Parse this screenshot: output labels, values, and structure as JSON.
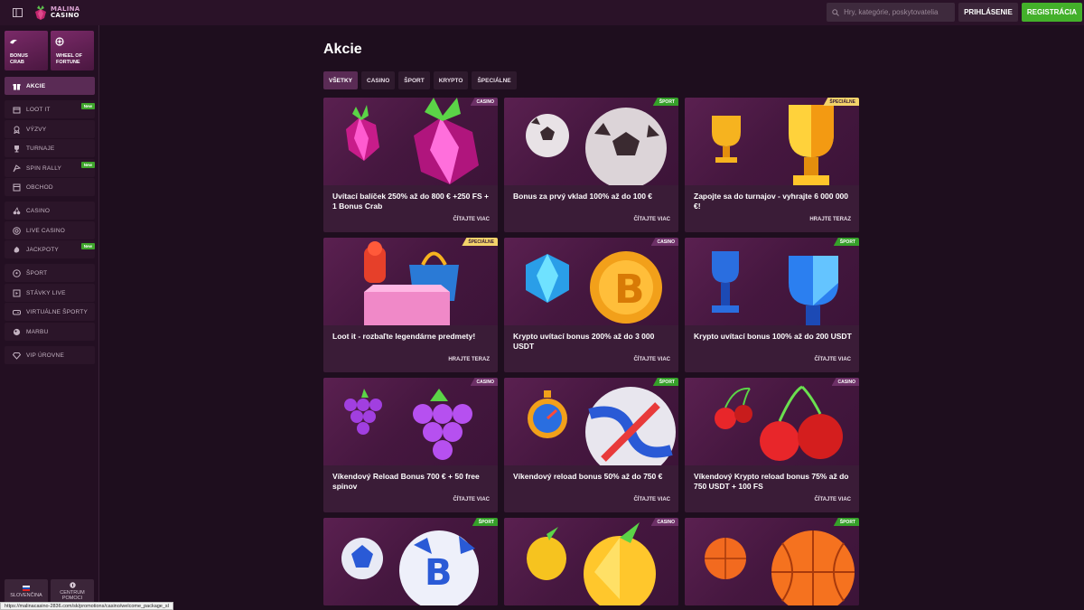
{
  "header": {
    "logo_top": "MALINA",
    "logo_bottom": "CASINO",
    "search_placeholder": "Hry, kategórie, poskytovatelia",
    "login_label": "PRIHLÁSENIE",
    "register_label": "REGISTRÁCIA"
  },
  "sidebar": {
    "featured": [
      {
        "label_1": "BONUS",
        "label_2": "CRAB",
        "icon": "crab-icon"
      },
      {
        "label_1": "WHEEL OF",
        "label_2": "FORTUNE",
        "icon": "wheel-icon"
      }
    ],
    "items": [
      {
        "label": "AKCIE",
        "icon": "gift-icon",
        "active": true
      },
      {
        "label": "LOOT IT",
        "icon": "box-icon",
        "badge": "New"
      },
      {
        "label": "VÝZVY",
        "icon": "badge-icon"
      },
      {
        "label": "TURNAJE",
        "icon": "trophy-icon"
      },
      {
        "label": "SPIN RALLY",
        "icon": "rally-icon",
        "badge": "New"
      },
      {
        "label": "OBCHOD",
        "icon": "shop-icon"
      },
      {
        "label": "CASINO",
        "icon": "cherry-icon"
      },
      {
        "label": "LIVE CASINO",
        "icon": "chip-icon"
      },
      {
        "label": "JACKPOTY",
        "icon": "jackpot-icon",
        "badge": "New"
      },
      {
        "label": "ŠPORT",
        "icon": "soccer-icon"
      },
      {
        "label": "STÁVKY LIVE",
        "icon": "live-icon"
      },
      {
        "label": "VIRTUÁLNE ŠPORTY",
        "icon": "virtual-icon"
      },
      {
        "label": "MARBU",
        "icon": "marble-icon"
      },
      {
        "label": "VIP ÚROVNE",
        "icon": "diamond-icon"
      }
    ],
    "language_label": "SLOVENČINA",
    "help_label_1": "CENTRUM",
    "help_label_2": "POMOCI"
  },
  "main": {
    "title": "Akcie",
    "tabs": [
      "VŠETKY",
      "CASINO",
      "ŠPORT",
      "KRYPTO",
      "ŠPECIÁLNE"
    ],
    "cards": [
      {
        "tag": "CASINO",
        "tag_type": "casino",
        "art": "raspberry",
        "title": "Uvítací balíček 250% až do 800 € +250 FS + 1 Bonus Crab",
        "link": "ČÍTAJTE VIAC"
      },
      {
        "tag": "ŠPORT",
        "tag_type": "sport",
        "art": "soccer",
        "title": "Bonus za prvý vklad 100% až do 100 €",
        "link": "ČÍTAJTE VIAC"
      },
      {
        "tag": "ŠPECIÁLNE",
        "tag_type": "special",
        "art": "trophy",
        "title": "Zapojte sa do turnajov - vyhrajte 6 000 000 €!",
        "link": "HRAJTE TERAZ"
      },
      {
        "tag": "ŠPECIÁLNE",
        "tag_type": "special",
        "art": "loot",
        "title": "Loot it - rozbaľte legendárne predmety!",
        "link": "HRAJTE TERAZ"
      },
      {
        "tag": "CASINO",
        "tag_type": "casino",
        "art": "crypto",
        "title": "Krypto uvítací bonus 200% až do 3 000 USDT",
        "link": "ČÍTAJTE VIAC"
      },
      {
        "tag": "ŠPORT",
        "tag_type": "sport",
        "art": "crypto-trophy",
        "title": "Krypto uvítací bonus 100% až do 200 USDT",
        "link": "ČÍTAJTE VIAC"
      },
      {
        "tag": "CASINO",
        "tag_type": "casino",
        "art": "grapes",
        "title": "Víkendový Reload Bonus 700 € + 50 free spinov",
        "link": "ČÍTAJTE VIAC"
      },
      {
        "tag": "ŠPORT",
        "tag_type": "sport",
        "art": "stopwatch",
        "title": "Víkendový reload bonus 50% až do 750 €",
        "link": "ČÍTAJTE VIAC"
      },
      {
        "tag": "CASINO",
        "tag_type": "casino",
        "art": "cherries",
        "title": "Víkendový Krypto reload bonus 75% až do 750 USDT + 100 FS",
        "link": "ČÍTAJTE VIAC"
      },
      {
        "tag": "ŠPORT",
        "tag_type": "sport",
        "art": "btc-ball",
        "title": "",
        "link": ""
      },
      {
        "tag": "CASINO",
        "tag_type": "casino",
        "art": "lemon",
        "title": "",
        "link": ""
      },
      {
        "tag": "ŠPORT",
        "tag_type": "sport",
        "art": "basketball",
        "title": "",
        "link": ""
      }
    ]
  },
  "status_url": "https://malinacasino-2836.com/sk/promotions/casino/welcome_package_sl",
  "colors": {
    "background": "#1e0e1e",
    "accent_purple": "#5a2b55",
    "register_green": "#43b02a",
    "sport_tag": "#36a02a",
    "special_tag": "#f3d36a"
  }
}
